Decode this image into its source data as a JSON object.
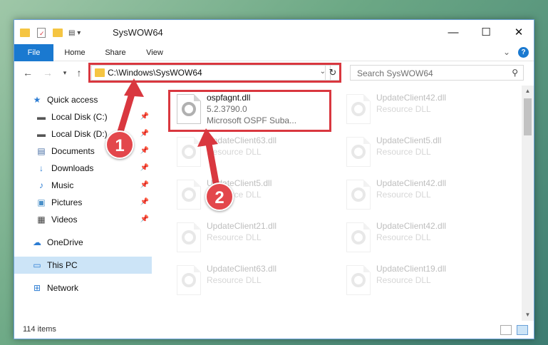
{
  "window": {
    "title": "SysWOW64",
    "controls": {
      "minimize": "—",
      "maximize": "☐",
      "close": "✕"
    }
  },
  "ribbon": {
    "tabs": [
      "File",
      "Home",
      "Share",
      "View"
    ],
    "expand_glyph": "⌄",
    "help_glyph": "?"
  },
  "nav": {
    "address": "C:\\Windows\\SysWOW64",
    "search_placeholder": "Search SysWOW64",
    "refresh_glyph": "↻"
  },
  "sidebar": {
    "items": [
      {
        "label": "Quick access",
        "icon": "star-icon",
        "glyph": "★",
        "color": "#2b7cd3",
        "pinned": false
      },
      {
        "label": "Local Disk (C:)",
        "icon": "drive-icon",
        "glyph": "▬",
        "color": "#555555",
        "pinned": true
      },
      {
        "label": "Local Disk (D:)",
        "icon": "drive-icon",
        "glyph": "▬",
        "color": "#555555",
        "pinned": true
      },
      {
        "label": "Documents",
        "icon": "documents-icon",
        "glyph": "▤",
        "color": "#4a6fa5",
        "pinned": true
      },
      {
        "label": "Downloads",
        "icon": "download-icon",
        "glyph": "↓",
        "color": "#2b7cd3",
        "pinned": true
      },
      {
        "label": "Music",
        "icon": "music-icon",
        "glyph": "♪",
        "color": "#2b7cd3",
        "pinned": true
      },
      {
        "label": "Pictures",
        "icon": "pictures-icon",
        "glyph": "▣",
        "color": "#4a90c8",
        "pinned": true
      },
      {
        "label": "Videos",
        "icon": "videos-icon",
        "glyph": "▦",
        "color": "#444444",
        "pinned": true
      },
      {
        "label": "OneDrive",
        "icon": "cloud-icon",
        "glyph": "☁",
        "color": "#2b7cd3",
        "pinned": false
      },
      {
        "label": "This PC",
        "icon": "computer-icon",
        "glyph": "▭",
        "color": "#2b7cd3",
        "pinned": false,
        "selected": true
      },
      {
        "label": "Network",
        "icon": "network-icon",
        "glyph": "⊞",
        "color": "#2b7cd3",
        "pinned": false
      }
    ]
  },
  "files": [
    {
      "name": "ospfagnt.dll",
      "version": "5.2.3790.0",
      "description": "Microsoft OSPF Suba...",
      "faded": false
    },
    {
      "name": "UpdateClient42.dll",
      "version": "",
      "description": "Resource DLL",
      "faded": true
    },
    {
      "name": "UpdateClient63.dll",
      "version": "",
      "description": "Resource DLL",
      "faded": true
    },
    {
      "name": "UpdateClient5.dll",
      "version": "",
      "description": "Resource DLL",
      "faded": true
    },
    {
      "name": "UpdateClient5.dll",
      "version": "",
      "description": "Resource DLL",
      "faded": true
    },
    {
      "name": "UpdateClient42.dll",
      "version": "",
      "description": "Resource DLL",
      "faded": true
    },
    {
      "name": "UpdateClient21.dll",
      "version": "",
      "description": "Resource DLL",
      "faded": true
    },
    {
      "name": "UpdateClient42.dll",
      "version": "",
      "description": "Resource DLL",
      "faded": true
    },
    {
      "name": "UpdateClient63.dll",
      "version": "",
      "description": "Resource DLL",
      "faded": true
    },
    {
      "name": "UpdateClient19.dll",
      "version": "",
      "description": "Resource DLL",
      "faded": true
    }
  ],
  "status": {
    "item_count": "114 items"
  },
  "annotations": {
    "marker1": "1",
    "marker2": "2",
    "color": "#d9373f"
  }
}
